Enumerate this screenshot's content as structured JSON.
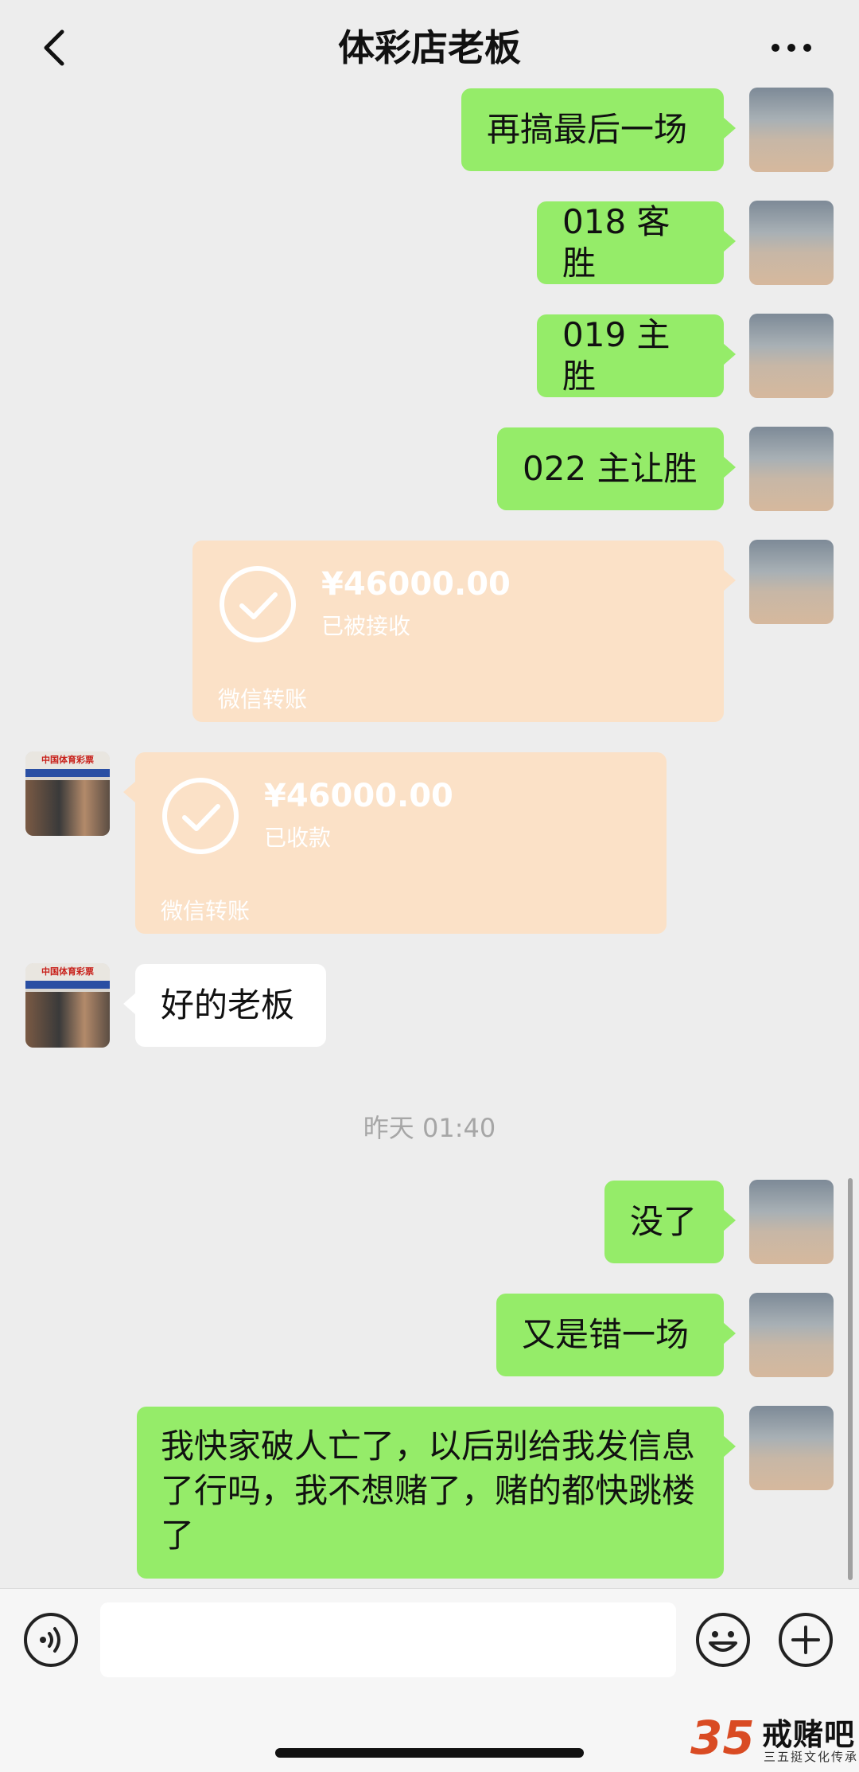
{
  "header": {
    "title": "体彩店老板"
  },
  "messages": [
    {
      "text": "再搞最后一场"
    },
    {
      "text": "018 客胜"
    },
    {
      "text": "019 主胜"
    },
    {
      "text": "022 主让胜"
    },
    {
      "amount": "¥46000.00",
      "status": "已被接收",
      "label": "微信转账"
    },
    {
      "amount": "¥46000.00",
      "status": "已收款",
      "label": "微信转账"
    },
    {
      "text": "好的老板"
    },
    {
      "text": "没了"
    },
    {
      "text": "又是错一场"
    },
    {
      "text": "我快家破人亡了，以后别给我发信息了行吗，我不想赌了，赌的都快跳楼了"
    }
  ],
  "timestamp": "昨天 01:40",
  "other_avatar_sign": "中国体育彩票",
  "input": {
    "placeholder": ""
  },
  "watermark": {
    "number": "35",
    "name": "戒赌吧",
    "subtitle": "三五挺文化传承"
  },
  "colors": {
    "bubble_green": "#95ec69",
    "transfer_peach": "#fbe1c7",
    "background": "#ededed"
  }
}
